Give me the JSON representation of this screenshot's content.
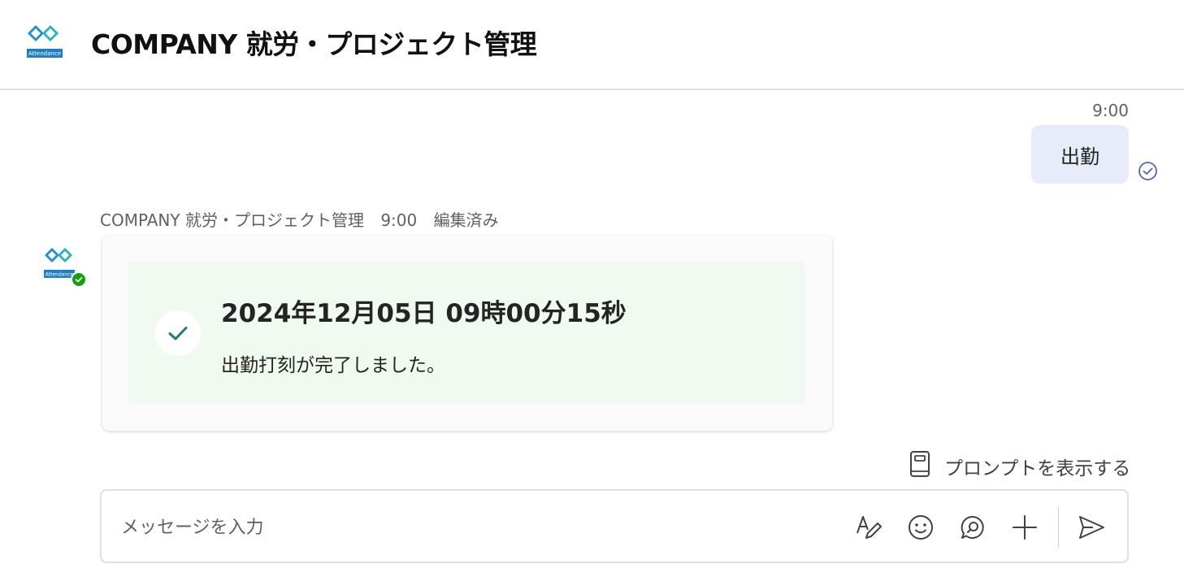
{
  "header": {
    "title": "COMPANY 就労・プロジェクト管理",
    "logo_text": "Attendance"
  },
  "sent_message": {
    "time": "9:00",
    "text": "出勤",
    "status_icon": "read-check-icon"
  },
  "bot_message": {
    "sender": "COMPANY 就労・プロジェクト管理",
    "time": "9:00",
    "edited_label": "編集済み",
    "avatar_logo_text": "Attendance",
    "card": {
      "title": "2024年12月05日 09時00分15秒",
      "body": "出勤打刻が完了しました。",
      "icon": "checkmark-icon"
    }
  },
  "prompts": {
    "label": "プロンプトを表示する",
    "icon": "book-icon"
  },
  "composer": {
    "placeholder": "メッセージを入力",
    "tools": [
      "format-icon",
      "emoji-icon",
      "loop-icon",
      "add-icon",
      "send-icon"
    ]
  },
  "colors": {
    "accent": "#5b5fc7",
    "sent_bubble": "#e8ebfa",
    "card_success_bg": "#f1faf1",
    "check_color": "#217a75",
    "presence_green": "#13a10e"
  }
}
